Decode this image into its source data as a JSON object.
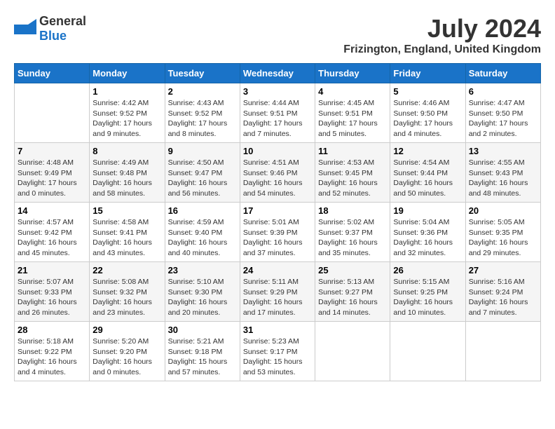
{
  "header": {
    "logo_general": "General",
    "logo_blue": "Blue",
    "month_title": "July 2024",
    "location": "Frizington, England, United Kingdom"
  },
  "calendar": {
    "days_of_week": [
      "Sunday",
      "Monday",
      "Tuesday",
      "Wednesday",
      "Thursday",
      "Friday",
      "Saturday"
    ],
    "weeks": [
      [
        {
          "day": "",
          "info": ""
        },
        {
          "day": "1",
          "info": "Sunrise: 4:42 AM\nSunset: 9:52 PM\nDaylight: 17 hours\nand 9 minutes."
        },
        {
          "day": "2",
          "info": "Sunrise: 4:43 AM\nSunset: 9:52 PM\nDaylight: 17 hours\nand 8 minutes."
        },
        {
          "day": "3",
          "info": "Sunrise: 4:44 AM\nSunset: 9:51 PM\nDaylight: 17 hours\nand 7 minutes."
        },
        {
          "day": "4",
          "info": "Sunrise: 4:45 AM\nSunset: 9:51 PM\nDaylight: 17 hours\nand 5 minutes."
        },
        {
          "day": "5",
          "info": "Sunrise: 4:46 AM\nSunset: 9:50 PM\nDaylight: 17 hours\nand 4 minutes."
        },
        {
          "day": "6",
          "info": "Sunrise: 4:47 AM\nSunset: 9:50 PM\nDaylight: 17 hours\nand 2 minutes."
        }
      ],
      [
        {
          "day": "7",
          "info": "Sunrise: 4:48 AM\nSunset: 9:49 PM\nDaylight: 17 hours\nand 0 minutes."
        },
        {
          "day": "8",
          "info": "Sunrise: 4:49 AM\nSunset: 9:48 PM\nDaylight: 16 hours\nand 58 minutes."
        },
        {
          "day": "9",
          "info": "Sunrise: 4:50 AM\nSunset: 9:47 PM\nDaylight: 16 hours\nand 56 minutes."
        },
        {
          "day": "10",
          "info": "Sunrise: 4:51 AM\nSunset: 9:46 PM\nDaylight: 16 hours\nand 54 minutes."
        },
        {
          "day": "11",
          "info": "Sunrise: 4:53 AM\nSunset: 9:45 PM\nDaylight: 16 hours\nand 52 minutes."
        },
        {
          "day": "12",
          "info": "Sunrise: 4:54 AM\nSunset: 9:44 PM\nDaylight: 16 hours\nand 50 minutes."
        },
        {
          "day": "13",
          "info": "Sunrise: 4:55 AM\nSunset: 9:43 PM\nDaylight: 16 hours\nand 48 minutes."
        }
      ],
      [
        {
          "day": "14",
          "info": "Sunrise: 4:57 AM\nSunset: 9:42 PM\nDaylight: 16 hours\nand 45 minutes."
        },
        {
          "day": "15",
          "info": "Sunrise: 4:58 AM\nSunset: 9:41 PM\nDaylight: 16 hours\nand 43 minutes."
        },
        {
          "day": "16",
          "info": "Sunrise: 4:59 AM\nSunset: 9:40 PM\nDaylight: 16 hours\nand 40 minutes."
        },
        {
          "day": "17",
          "info": "Sunrise: 5:01 AM\nSunset: 9:39 PM\nDaylight: 16 hours\nand 37 minutes."
        },
        {
          "day": "18",
          "info": "Sunrise: 5:02 AM\nSunset: 9:37 PM\nDaylight: 16 hours\nand 35 minutes."
        },
        {
          "day": "19",
          "info": "Sunrise: 5:04 AM\nSunset: 9:36 PM\nDaylight: 16 hours\nand 32 minutes."
        },
        {
          "day": "20",
          "info": "Sunrise: 5:05 AM\nSunset: 9:35 PM\nDaylight: 16 hours\nand 29 minutes."
        }
      ],
      [
        {
          "day": "21",
          "info": "Sunrise: 5:07 AM\nSunset: 9:33 PM\nDaylight: 16 hours\nand 26 minutes."
        },
        {
          "day": "22",
          "info": "Sunrise: 5:08 AM\nSunset: 9:32 PM\nDaylight: 16 hours\nand 23 minutes."
        },
        {
          "day": "23",
          "info": "Sunrise: 5:10 AM\nSunset: 9:30 PM\nDaylight: 16 hours\nand 20 minutes."
        },
        {
          "day": "24",
          "info": "Sunrise: 5:11 AM\nSunset: 9:29 PM\nDaylight: 16 hours\nand 17 minutes."
        },
        {
          "day": "25",
          "info": "Sunrise: 5:13 AM\nSunset: 9:27 PM\nDaylight: 16 hours\nand 14 minutes."
        },
        {
          "day": "26",
          "info": "Sunrise: 5:15 AM\nSunset: 9:25 PM\nDaylight: 16 hours\nand 10 minutes."
        },
        {
          "day": "27",
          "info": "Sunrise: 5:16 AM\nSunset: 9:24 PM\nDaylight: 16 hours\nand 7 minutes."
        }
      ],
      [
        {
          "day": "28",
          "info": "Sunrise: 5:18 AM\nSunset: 9:22 PM\nDaylight: 16 hours\nand 4 minutes."
        },
        {
          "day": "29",
          "info": "Sunrise: 5:20 AM\nSunset: 9:20 PM\nDaylight: 16 hours\nand 0 minutes."
        },
        {
          "day": "30",
          "info": "Sunrise: 5:21 AM\nSunset: 9:18 PM\nDaylight: 15 hours\nand 57 minutes."
        },
        {
          "day": "31",
          "info": "Sunrise: 5:23 AM\nSunset: 9:17 PM\nDaylight: 15 hours\nand 53 minutes."
        },
        {
          "day": "",
          "info": ""
        },
        {
          "day": "",
          "info": ""
        },
        {
          "day": "",
          "info": ""
        }
      ]
    ]
  }
}
